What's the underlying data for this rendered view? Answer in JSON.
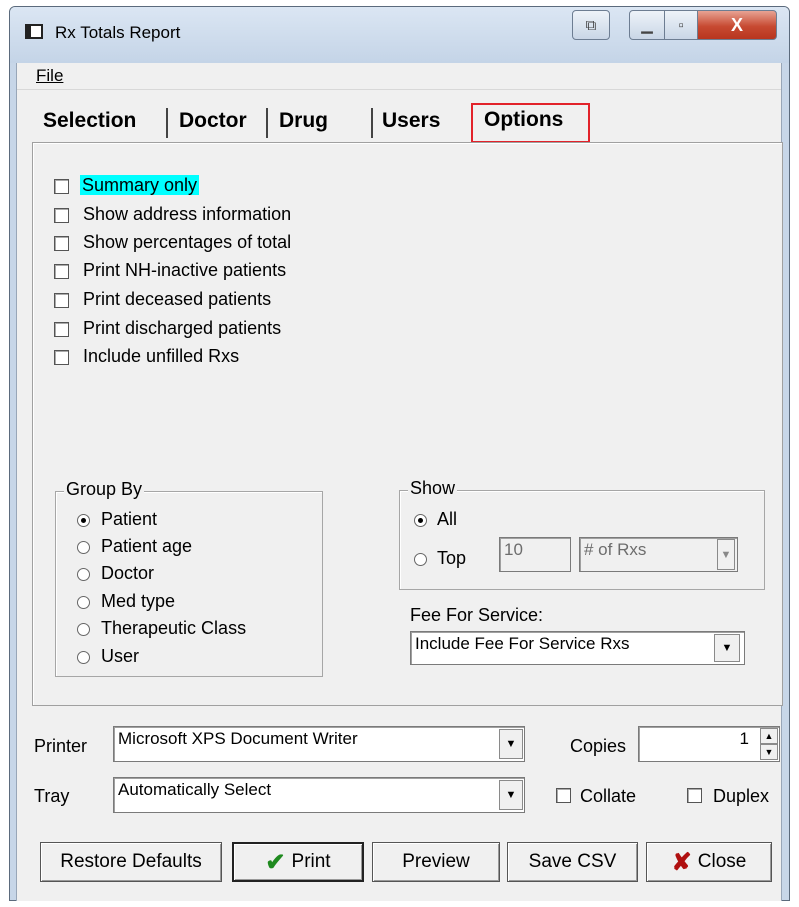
{
  "window": {
    "title": "Rx Totals Report",
    "buttons": {
      "restore_glyph": "⧉",
      "minimize_glyph": "▁",
      "maximize_glyph": "▫",
      "close_glyph": "X"
    }
  },
  "menu": {
    "file": "File"
  },
  "tabs": [
    {
      "label": "Selection",
      "active": false
    },
    {
      "label": "Doctor",
      "active": false
    },
    {
      "label": "Drug",
      "active": false
    },
    {
      "label": "Users",
      "active": false
    },
    {
      "label": "Options",
      "active": true
    }
  ],
  "options": [
    {
      "label": "Summary only",
      "checked": false,
      "highlight": true
    },
    {
      "label": "Show address information",
      "checked": false
    },
    {
      "label": "Show percentages of total",
      "checked": false
    },
    {
      "label": "Print NH-inactive patients",
      "checked": false
    },
    {
      "label": "Print deceased patients",
      "checked": false
    },
    {
      "label": "Print discharged patients",
      "checked": false
    },
    {
      "label": "Include unfilled Rxs",
      "checked": false
    }
  ],
  "group_by": {
    "title": "Group By",
    "items": [
      {
        "label": "Patient",
        "selected": true
      },
      {
        "label": "Patient age",
        "selected": false
      },
      {
        "label": "Doctor",
        "selected": false
      },
      {
        "label": "Med type",
        "selected": false
      },
      {
        "label": "Therapeutic Class",
        "selected": false
      },
      {
        "label": "User",
        "selected": false
      }
    ]
  },
  "show": {
    "title": "Show",
    "all_label": "All",
    "top_label": "Top",
    "top_value": "10",
    "top_metric": "# of Rxs"
  },
  "fee_for_service": {
    "label": "Fee For Service:",
    "value": "Include Fee For Service Rxs"
  },
  "printer": {
    "label": "Printer",
    "value": "Microsoft XPS Document Writer",
    "copies_label": "Copies",
    "copies_value": "1",
    "tray_label": "Tray",
    "tray_value": "Automatically Select",
    "collate_label": "Collate",
    "duplex_label": "Duplex"
  },
  "buttons": {
    "restore_defaults": "Restore Defaults",
    "print": "Print",
    "preview": "Preview",
    "save_csv": "Save CSV",
    "close": "Close"
  },
  "colors": {
    "highlight": "#00ffff",
    "active_tab_outline": "#e2222a",
    "print_check": "#1f8a1f",
    "close_x": "#b01010"
  }
}
